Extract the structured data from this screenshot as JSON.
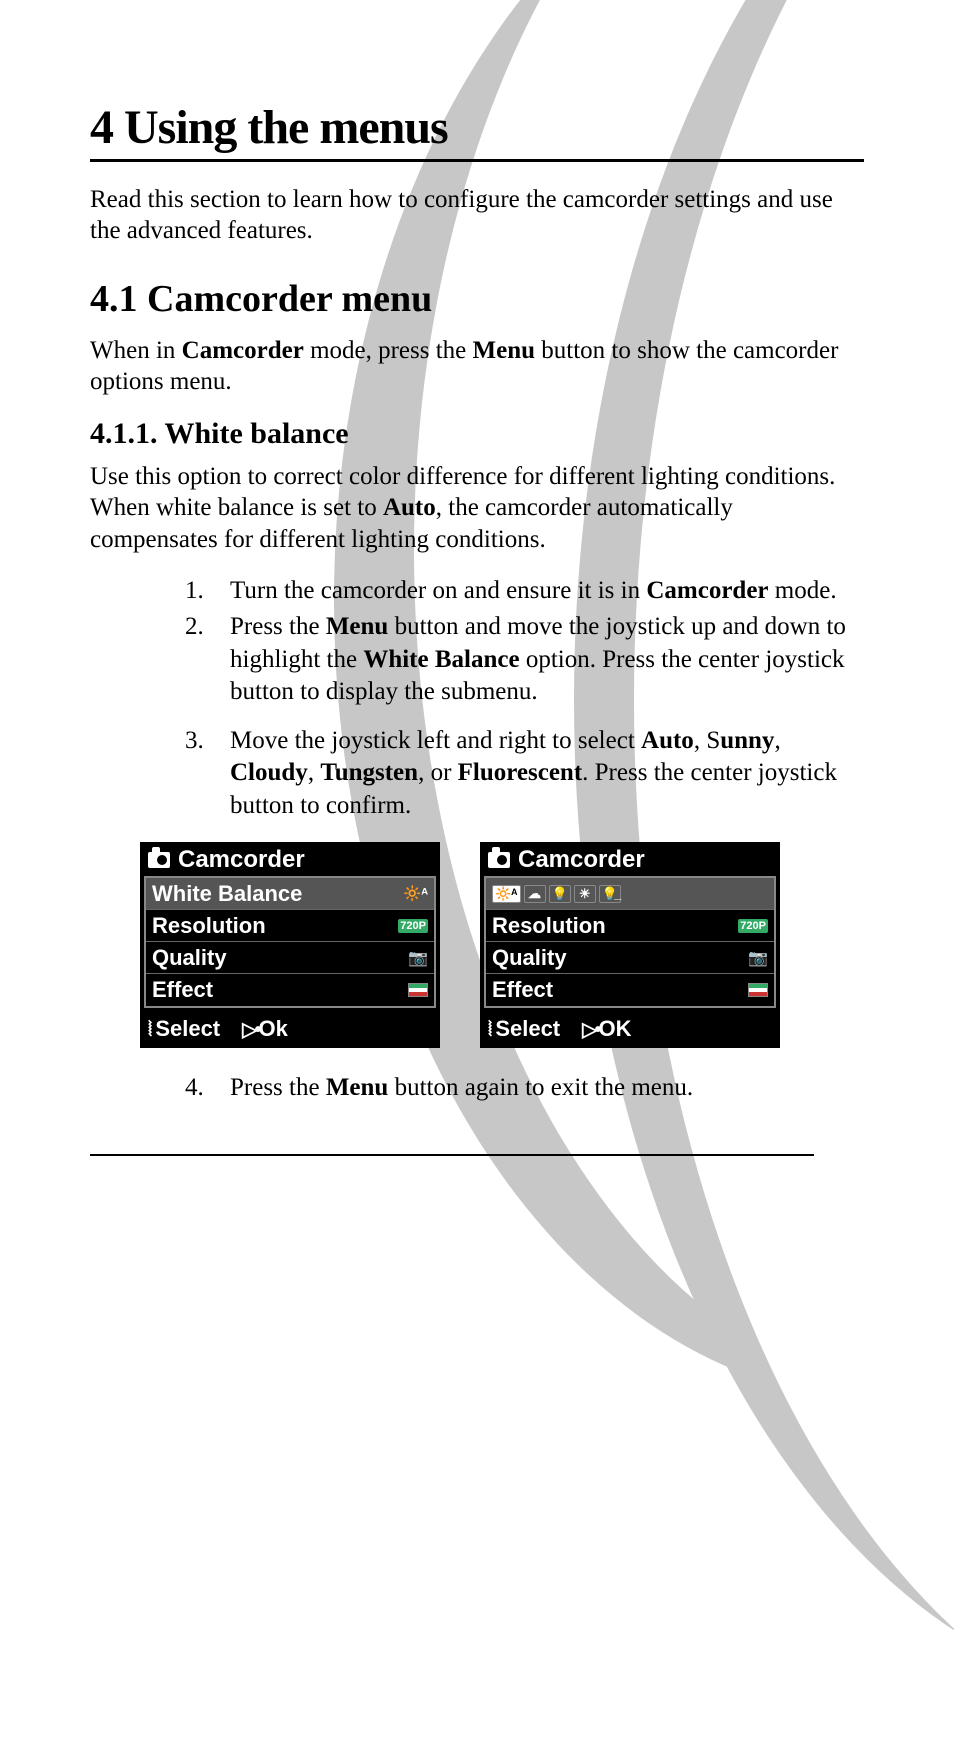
{
  "h1": "4   Using the menus",
  "intro": "Read this section to learn how to configure the camcorder settings and use the advanced features.",
  "h2": "4.1 Camcorder menu",
  "p2_a": "When in ",
  "p2_b": "Camcorder",
  "p2_c": " mode, press the ",
  "p2_d": "Menu",
  "p2_e": " button to show the camcorder options menu.",
  "h3": "4.1.1. White balance",
  "p3_a": "Use this option to correct color difference for different lighting conditions. When white balance is set to ",
  "p3_b": "Auto",
  "p3_c": ", the camcorder automatically compensates for different lighting conditions.",
  "li1_a": "Turn the camcorder on and ensure it is in ",
  "li1_b": "Camcorder",
  "li1_c": " mode.",
  "li2_a": "Press the ",
  "li2_b": "Menu",
  "li2_c": " button and move the joystick up and down to highlight the ",
  "li2_d": "White Balance",
  "li2_e": " option. Press the center joystick button to display the submenu.",
  "li3_a": "Move the joystick left and right to select ",
  "li3_b": "Auto",
  "li3_c": ", S",
  "li3_d": "unny",
  "li3_e": ", ",
  "li3_f": "Cloudy",
  "li3_g": ", ",
  "li3_h": "Tungsten",
  "li3_i": ", or ",
  "li3_j": "Fluorescent",
  "li3_k": ". Press the center joystick button to confirm.",
  "li4_a": "Press the ",
  "li4_b": "Menu",
  "li4_c": " button again to exit the menu.",
  "screen": {
    "title": "Camcorder",
    "wb": "White Balance",
    "res": "Resolution",
    "res_val": "720P",
    "qual": "Quality",
    "eff": "Effect",
    "select": "Select",
    "ok1": "Ok",
    "ok2": "OK",
    "wb_auto": "🔆ᴬ",
    "film": "📷",
    "joy_updown": "⦚",
    "joy_press": "▷•"
  }
}
